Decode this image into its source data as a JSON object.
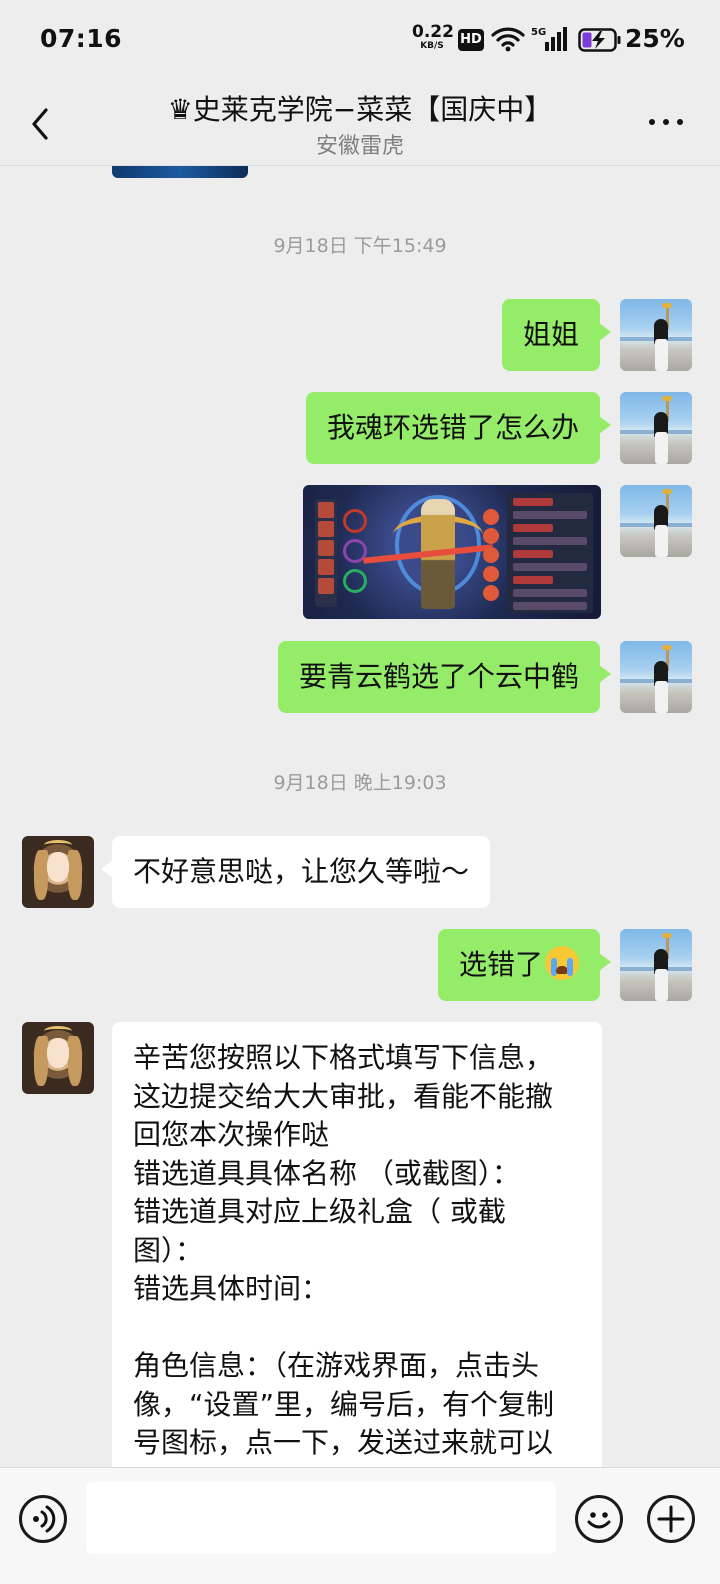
{
  "status_bar": {
    "time": "07:16",
    "net_speed_value": "0.22",
    "net_speed_unit": "KB/S",
    "hd_badge": "HD",
    "network_type": "5G",
    "battery_percent": "25%",
    "battery_charging": true,
    "icons": [
      "wifi-icon",
      "signal-icon",
      "battery-charging-icon"
    ]
  },
  "header": {
    "title": "♛史莱克学院−菜菜【国庆中】",
    "subtitle": "安徽雷虎",
    "back_icon": "chevron-left-icon",
    "more_icon": "ellipsis-icon"
  },
  "messages": {
    "timestamp_1": "9月18日 下午15:49",
    "out_1": "姐姐",
    "out_2": "我魂环选错了怎么办",
    "out_3_image": "game-screenshot",
    "out_4": "要青云鹤选了个云中鹤",
    "timestamp_2": "9月18日 晚上19:03",
    "in_1": "不好意思哒，让您久等啦～",
    "out_5": "选错了",
    "out_5_emoji": "loudly-crying-face",
    "in_2": "辛苦您按照以下格式填写下信息，\n这边提交给大大审批，看能不能撤\n回您本次操作哒\n错选道具具体名称 （或截图）：\n错选道具对应上级礼盒（ 或截\n图）：\n错选具体时间：\n\n角色信息：（在游戏界面，点击头\n像，“设置”里，编号后，有个复制\n号图标，点一下，发送过来就可以"
  },
  "input_bar": {
    "placeholder": "",
    "voice_icon": "voice-icon",
    "emoji_icon": "emoji-icon",
    "plus_icon": "plus-icon"
  }
}
